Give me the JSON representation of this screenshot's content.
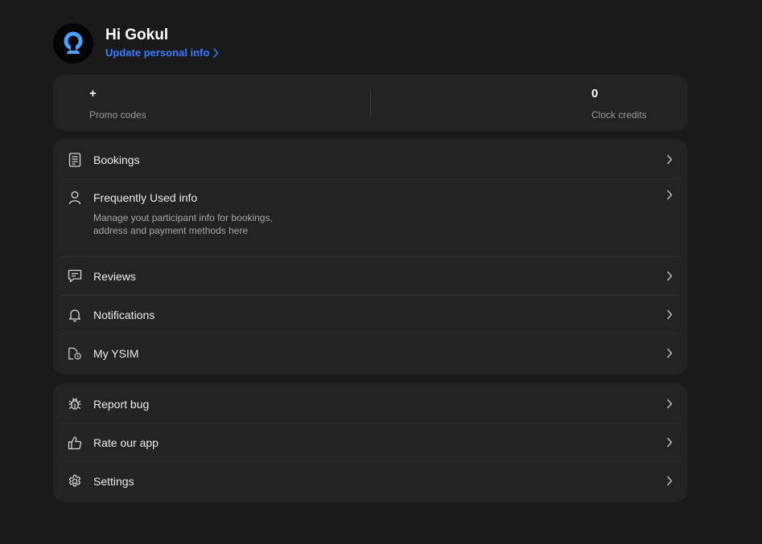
{
  "profile": {
    "greeting": "Hi Gokul",
    "update_link": "Update personal info"
  },
  "stats": {
    "promo_value": "+",
    "promo_label": "Promo codes",
    "credits_value": "0",
    "credits_label": "Clock credits"
  },
  "menu_primary": [
    {
      "label": "Bookings",
      "icon": "document-list-icon"
    },
    {
      "label": "Frequently Used info",
      "icon": "user-icon",
      "description": "Manage yout participant info for bookings, address and payment methods here"
    },
    {
      "label": "Reviews",
      "icon": "message-icon"
    },
    {
      "label": "Notifications",
      "icon": "bell-icon"
    },
    {
      "label": "My YSIM",
      "icon": "sim-file-icon"
    }
  ],
  "menu_secondary": [
    {
      "label": "Report bug",
      "icon": "bug-icon"
    },
    {
      "label": "Rate our app",
      "icon": "thumbs-up-icon"
    },
    {
      "label": "Settings",
      "icon": "gear-icon"
    }
  ],
  "colors": {
    "background": "#1a1a1a",
    "card": "#232323",
    "accent_link": "#3d7bff",
    "avatar_ring": "#4aa3ff"
  }
}
